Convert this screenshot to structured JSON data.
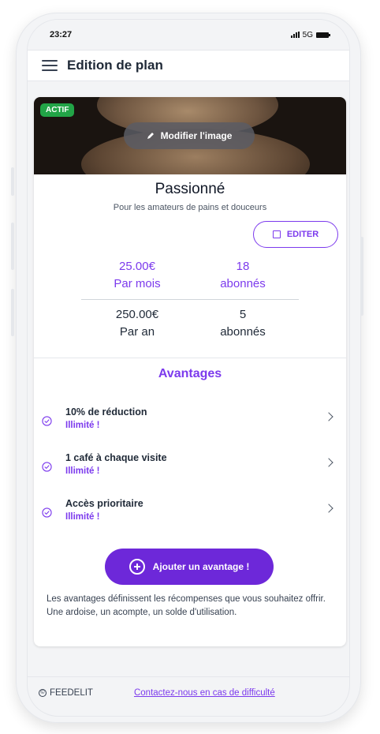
{
  "status_bar": {
    "time": "23:27",
    "network": "5G"
  },
  "header": {
    "title": "Edition de plan",
    "menu_icon": "hamburger-menu-icon"
  },
  "plan": {
    "badge": "ACTIF",
    "edit_image_label": "Modifier l'image",
    "name": "Passionné",
    "description": "Pour les amateurs de pains et douceurs",
    "edit_label": "EDITER",
    "monthly": {
      "price": "25.00€",
      "period": "Par mois",
      "count": "18",
      "count_label": "abonnés"
    },
    "yearly": {
      "price": "250.00€",
      "period": "Par an",
      "count": "5",
      "count_label": "abonnés"
    }
  },
  "benefits": {
    "title": "Avantages",
    "items": [
      {
        "title": "10% de réduction",
        "subtitle": "Illimité !"
      },
      {
        "title": "1 café à chaque visite",
        "subtitle": "Illimité !"
      },
      {
        "title": "Accès prioritaire",
        "subtitle": "Illimité !"
      }
    ],
    "add_label": "Ajouter un avantage !",
    "help_text": "Les avantages définissent les récompenses que vous souhaitez offrir. Une ardoise, un acompte, un solde d'utilisation."
  },
  "footer": {
    "brand": "FEEDELIT",
    "contact_link": "Contactez-nous en cas de difficulté"
  },
  "colors": {
    "accent": "#7c3aed",
    "active_badge": "#22a447",
    "button": "#6d28d9"
  }
}
